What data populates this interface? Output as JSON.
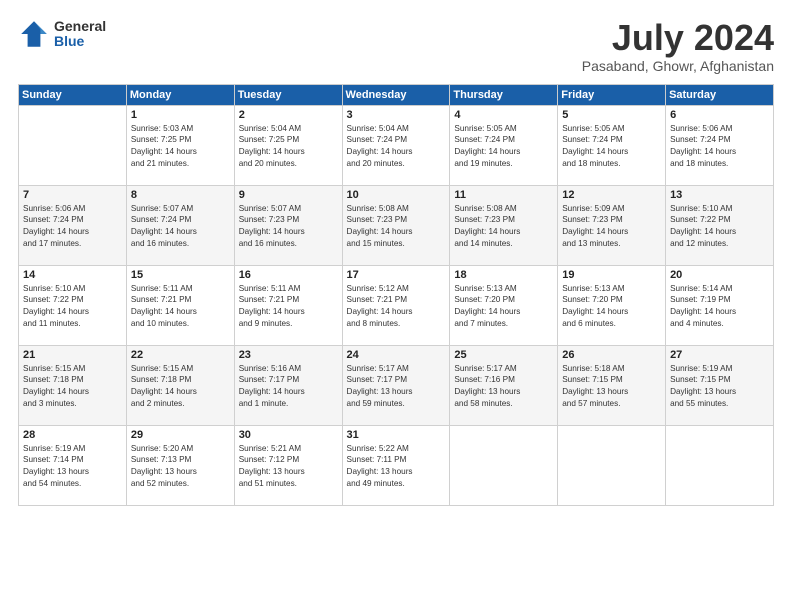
{
  "header": {
    "logo_general": "General",
    "logo_blue": "Blue",
    "month_year": "July 2024",
    "location": "Pasaband, Ghowr, Afghanistan"
  },
  "calendar": {
    "days_of_week": [
      "Sunday",
      "Monday",
      "Tuesday",
      "Wednesday",
      "Thursday",
      "Friday",
      "Saturday"
    ],
    "weeks": [
      [
        {
          "day": "",
          "info": ""
        },
        {
          "day": "1",
          "info": "Sunrise: 5:03 AM\nSunset: 7:25 PM\nDaylight: 14 hours\nand 21 minutes."
        },
        {
          "day": "2",
          "info": "Sunrise: 5:04 AM\nSunset: 7:25 PM\nDaylight: 14 hours\nand 20 minutes."
        },
        {
          "day": "3",
          "info": "Sunrise: 5:04 AM\nSunset: 7:24 PM\nDaylight: 14 hours\nand 20 minutes."
        },
        {
          "day": "4",
          "info": "Sunrise: 5:05 AM\nSunset: 7:24 PM\nDaylight: 14 hours\nand 19 minutes."
        },
        {
          "day": "5",
          "info": "Sunrise: 5:05 AM\nSunset: 7:24 PM\nDaylight: 14 hours\nand 18 minutes."
        },
        {
          "day": "6",
          "info": "Sunrise: 5:06 AM\nSunset: 7:24 PM\nDaylight: 14 hours\nand 18 minutes."
        }
      ],
      [
        {
          "day": "7",
          "info": "Sunrise: 5:06 AM\nSunset: 7:24 PM\nDaylight: 14 hours\nand 17 minutes."
        },
        {
          "day": "8",
          "info": "Sunrise: 5:07 AM\nSunset: 7:24 PM\nDaylight: 14 hours\nand 16 minutes."
        },
        {
          "day": "9",
          "info": "Sunrise: 5:07 AM\nSunset: 7:23 PM\nDaylight: 14 hours\nand 16 minutes."
        },
        {
          "day": "10",
          "info": "Sunrise: 5:08 AM\nSunset: 7:23 PM\nDaylight: 14 hours\nand 15 minutes."
        },
        {
          "day": "11",
          "info": "Sunrise: 5:08 AM\nSunset: 7:23 PM\nDaylight: 14 hours\nand 14 minutes."
        },
        {
          "day": "12",
          "info": "Sunrise: 5:09 AM\nSunset: 7:23 PM\nDaylight: 14 hours\nand 13 minutes."
        },
        {
          "day": "13",
          "info": "Sunrise: 5:10 AM\nSunset: 7:22 PM\nDaylight: 14 hours\nand 12 minutes."
        }
      ],
      [
        {
          "day": "14",
          "info": "Sunrise: 5:10 AM\nSunset: 7:22 PM\nDaylight: 14 hours\nand 11 minutes."
        },
        {
          "day": "15",
          "info": "Sunrise: 5:11 AM\nSunset: 7:21 PM\nDaylight: 14 hours\nand 10 minutes."
        },
        {
          "day": "16",
          "info": "Sunrise: 5:11 AM\nSunset: 7:21 PM\nDaylight: 14 hours\nand 9 minutes."
        },
        {
          "day": "17",
          "info": "Sunrise: 5:12 AM\nSunset: 7:21 PM\nDaylight: 14 hours\nand 8 minutes."
        },
        {
          "day": "18",
          "info": "Sunrise: 5:13 AM\nSunset: 7:20 PM\nDaylight: 14 hours\nand 7 minutes."
        },
        {
          "day": "19",
          "info": "Sunrise: 5:13 AM\nSunset: 7:20 PM\nDaylight: 14 hours\nand 6 minutes."
        },
        {
          "day": "20",
          "info": "Sunrise: 5:14 AM\nSunset: 7:19 PM\nDaylight: 14 hours\nand 4 minutes."
        }
      ],
      [
        {
          "day": "21",
          "info": "Sunrise: 5:15 AM\nSunset: 7:18 PM\nDaylight: 14 hours\nand 3 minutes."
        },
        {
          "day": "22",
          "info": "Sunrise: 5:15 AM\nSunset: 7:18 PM\nDaylight: 14 hours\nand 2 minutes."
        },
        {
          "day": "23",
          "info": "Sunrise: 5:16 AM\nSunset: 7:17 PM\nDaylight: 14 hours\nand 1 minute."
        },
        {
          "day": "24",
          "info": "Sunrise: 5:17 AM\nSunset: 7:17 PM\nDaylight: 13 hours\nand 59 minutes."
        },
        {
          "day": "25",
          "info": "Sunrise: 5:17 AM\nSunset: 7:16 PM\nDaylight: 13 hours\nand 58 minutes."
        },
        {
          "day": "26",
          "info": "Sunrise: 5:18 AM\nSunset: 7:15 PM\nDaylight: 13 hours\nand 57 minutes."
        },
        {
          "day": "27",
          "info": "Sunrise: 5:19 AM\nSunset: 7:15 PM\nDaylight: 13 hours\nand 55 minutes."
        }
      ],
      [
        {
          "day": "28",
          "info": "Sunrise: 5:19 AM\nSunset: 7:14 PM\nDaylight: 13 hours\nand 54 minutes."
        },
        {
          "day": "29",
          "info": "Sunrise: 5:20 AM\nSunset: 7:13 PM\nDaylight: 13 hours\nand 52 minutes."
        },
        {
          "day": "30",
          "info": "Sunrise: 5:21 AM\nSunset: 7:12 PM\nDaylight: 13 hours\nand 51 minutes."
        },
        {
          "day": "31",
          "info": "Sunrise: 5:22 AM\nSunset: 7:11 PM\nDaylight: 13 hours\nand 49 minutes."
        },
        {
          "day": "",
          "info": ""
        },
        {
          "day": "",
          "info": ""
        },
        {
          "day": "",
          "info": ""
        }
      ]
    ]
  }
}
